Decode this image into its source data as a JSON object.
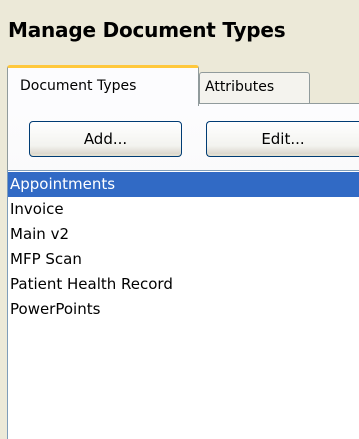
{
  "header": {
    "title": "Manage Document Types"
  },
  "tabs": [
    {
      "label": "Document Types",
      "selected": true
    },
    {
      "label": "Attributes",
      "selected": false
    }
  ],
  "toolbar": {
    "add_label": "Add...",
    "edit_label": "Edit..."
  },
  "document_types": {
    "selected_index": 0,
    "items": [
      "Appointments",
      "Invoice",
      "Main v2",
      "MFP Scan",
      "Patient Health Record",
      "PowerPoints"
    ]
  },
  "colors": {
    "selection": "#316ac5",
    "active_tab_accent": "#ffc83c",
    "window_background": "#ece9d8"
  }
}
